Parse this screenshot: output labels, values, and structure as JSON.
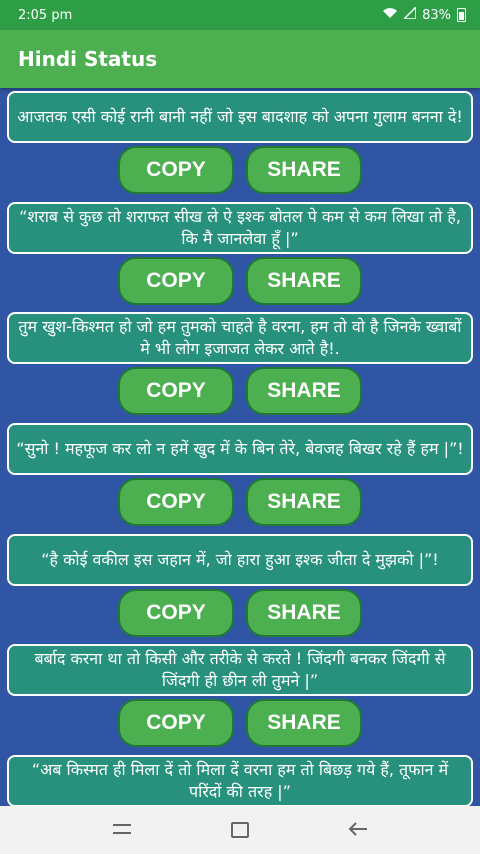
{
  "status_bar": {
    "time": "2:05 pm",
    "battery": "83%"
  },
  "app_bar": {
    "title": "Hindi Status"
  },
  "buttons": {
    "copy": "COPY",
    "share": "SHARE"
  },
  "statuses": [
    "आजतक एसी कोई रानी बानी नहीं जो इस बादशाह को अपना गुलाम बनना दे!",
    "“शराब से कुछ तो शराफत सीख ले ऐ इश्क बोतल पे कम से कम लिखा तो है, कि मै जानलेवा हूँ |”",
    "तुम खुश-किश्मत हो जो हम तुमको चाहते है वरना, हम तो वो है जिनके ख्वाबों मे भी लोग इजाजत लेकर आते है!.",
    "“सुनो ! महफूज कर लो न हमें खुद में के बिन तेरे, बेवजह बिखर रहे हैं हम |”!",
    "“है कोई वकील इस जहान में, जो हारा हुआ इश्क जीता दे मुझको |”!",
    "बर्बाद करना था तो किसी और तरीके से करते ! जिंदगी बनकर जिंदगी से जिंदगी ही छीन ली तुमने |”",
    "“अब किस्मत ही मिला दें तो मिला दें वरना हम तो बिछड़ गये हैं, तूफान में परिंदों की तरह |”"
  ]
}
